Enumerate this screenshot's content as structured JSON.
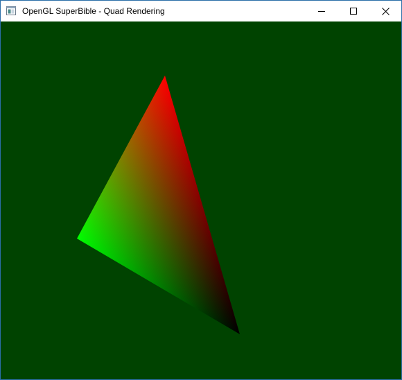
{
  "window": {
    "title": "OpenGL SuperBible - Quad Rendering"
  },
  "caption_buttons": {
    "minimize_icon": "minimize-icon",
    "maximize_icon": "maximize-icon",
    "close_icon": "close-icon"
  },
  "scene": {
    "clear_color": "#004300",
    "triangle": {
      "vertex_colors": [
        "#ff0000",
        "#00ff00",
        "#000000"
      ]
    }
  }
}
